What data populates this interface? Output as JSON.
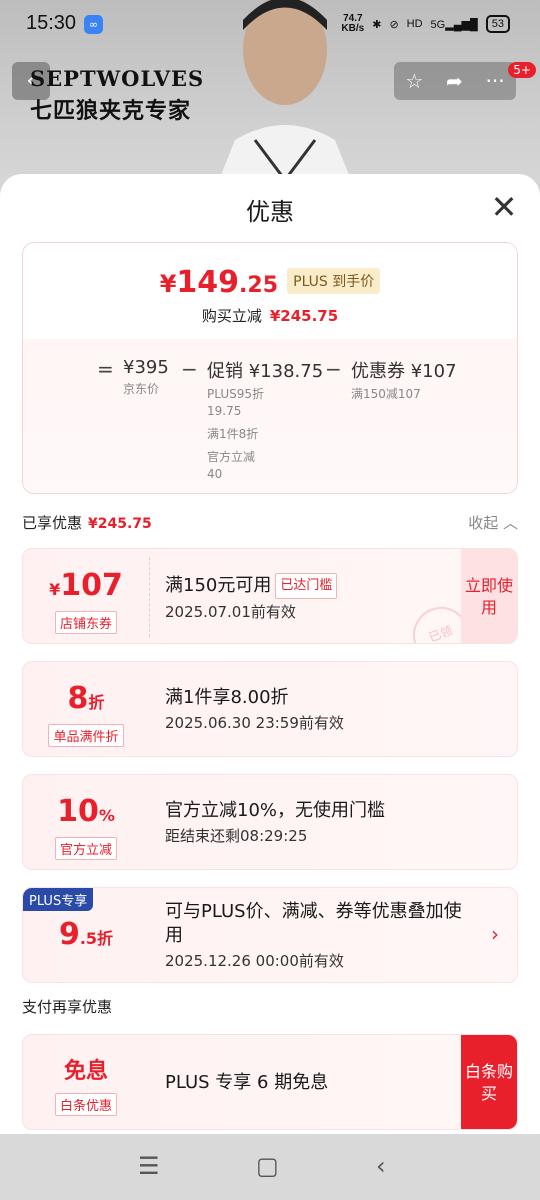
{
  "status": {
    "time": "15:30",
    "app_icon": "link-app-icon",
    "speed_value": "74.7",
    "speed_unit": "KB/s",
    "hd": "HD",
    "signal": "5G",
    "battery": "53"
  },
  "header": {
    "brand_en": "SEPTWOLVES",
    "brand_cn": "七匹狼夹克专家",
    "cart_count": "5+"
  },
  "sheet": {
    "title": "优惠",
    "price": {
      "currency": "¥",
      "integer": "149",
      "decimal": ".25",
      "plus_tag": "PLUS 到手价"
    },
    "reduce_label": "购买立减",
    "reduce_value": "¥245.75",
    "breakdown": {
      "equals": "=",
      "minus": "−",
      "jd_price": "¥395",
      "jd_label": "京东价",
      "promo_value": "促销 ¥138.75",
      "promo_lines": [
        "PLUS95折",
        "19.75",
        "满1件8折",
        "官方立减",
        "40"
      ],
      "coupon_value": "优惠券 ¥107",
      "coupon_label": "满150减107"
    },
    "enjoyed_label": "已享优惠",
    "enjoyed_value": "¥245.75",
    "collapse_label": "收起 ︿",
    "coupons": [
      {
        "amount_prefix": "¥",
        "amount": "107",
        "tag": "店铺东券",
        "title": "满150元可用",
        "badge": "已达门槛",
        "date": "2025.07.01前有效",
        "action": "立即使用",
        "stamp": "已领"
      },
      {
        "amount": "8",
        "amount_suffix": "折",
        "tag": "单品满件折",
        "title": "满1件享8.00折",
        "date": "2025.06.30 23:59前有效"
      },
      {
        "amount": "10",
        "amount_suffix": "%",
        "tag": "官方立减",
        "title": "官方立减10%，无使用门槛",
        "date": "距结束还剩08:29:25"
      },
      {
        "ribbon": "PLUS专享",
        "amount": "9",
        "amount_suffix": ".5折",
        "title": "可与PLUS价、满减、券等优惠叠加使用",
        "date": "2025.12.26 00:00前有效"
      }
    ],
    "pay_section_label": "支付再享优惠",
    "pay_offer": {
      "amount": "免息",
      "tag": "白条优惠",
      "title": "PLUS 专享 6 期免息",
      "action": "白条购买"
    }
  },
  "colors": {
    "accent": "#e8202c",
    "plus_blue": "#2a4aa8"
  }
}
